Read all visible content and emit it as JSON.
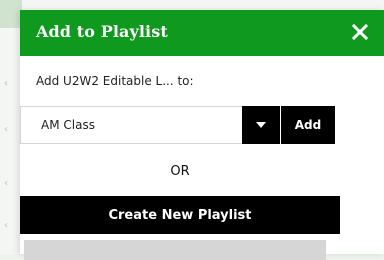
{
  "modal": {
    "title": "Add to Playlist",
    "close_icon": "close-icon",
    "prompt": "Add U2W2 Editable L... to:",
    "select": {
      "value": "AM Class"
    },
    "dropdown_icon": "chevron-down-icon",
    "add_label": "Add",
    "or_label": "OR",
    "create_label": "Create New Playlist"
  },
  "colors": {
    "header_bg": "#0f9a1f",
    "button_bg": "#000000",
    "button_text": "#ffffff"
  }
}
